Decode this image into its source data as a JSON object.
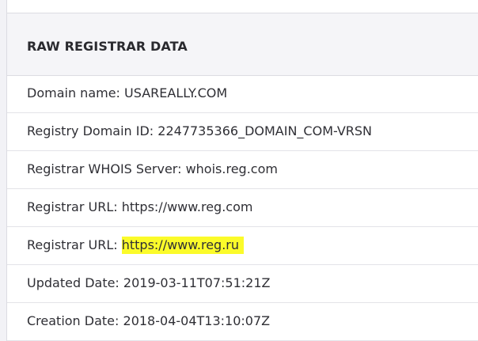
{
  "section": {
    "title": "RAW REGISTRAR DATA"
  },
  "rows": [
    {
      "label": "Domain name:",
      "value": "USAREALLY.COM"
    },
    {
      "label": "Registry Domain ID:",
      "value": "2247735366_DOMAIN_COM-VRSN"
    },
    {
      "label": "Registrar WHOIS Server:",
      "value": "whois.reg.com"
    },
    {
      "label": "Registrar URL:",
      "value": "https://www.reg.com"
    },
    {
      "label": "Registrar URL:",
      "value": "https://www.reg.ru",
      "highlighted": true
    },
    {
      "label": "Updated Date:",
      "value": "2019-03-11T07:51:21Z"
    },
    {
      "label": "Creation Date:",
      "value": "2018-04-04T13:10:07Z"
    }
  ],
  "colors": {
    "highlight": "#fbfb2a",
    "header_bg": "#f5f5f8",
    "text": "#2f2f35"
  }
}
